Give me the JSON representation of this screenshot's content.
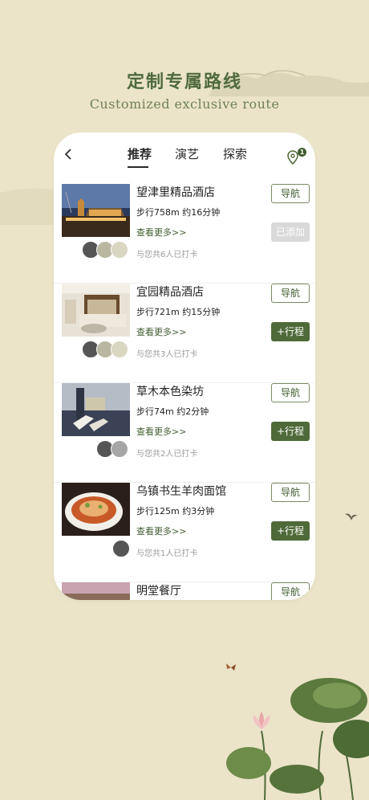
{
  "header": {
    "title": "定制专属路线",
    "subtitle": "Customized exclusive route"
  },
  "tabs": [
    {
      "label": "推荐",
      "active": true
    },
    {
      "label": "演艺",
      "active": false
    },
    {
      "label": "探索",
      "active": false
    }
  ],
  "location_badge": "1",
  "items": [
    {
      "name": "望津里精品酒店",
      "distance": "步行758m 约16分钟",
      "more": "查看更多>>",
      "checkin": "与您共6人已打卡",
      "nav_label": "导航",
      "action_label": "已添加",
      "action_state": "added",
      "avatars": 3
    },
    {
      "name": "宜园精品酒店",
      "distance": "步行721m 约15分钟",
      "more": "查看更多>>",
      "checkin": "与您共3人已打卡",
      "nav_label": "导航",
      "action_label": "+行程",
      "action_state": "add",
      "avatars": 3
    },
    {
      "name": "草木本色染坊",
      "distance": "步行74m 约2分钟",
      "more": "查看更多>>",
      "checkin": "与您共2人已打卡",
      "nav_label": "导航",
      "action_label": "+行程",
      "action_state": "add",
      "avatars": 2
    },
    {
      "name": "乌镇书生羊肉面馆",
      "distance": "步行125m 约3分钟",
      "more": "查看更多>>",
      "checkin": "与您共1人已打卡",
      "nav_label": "导航",
      "action_label": "+行程",
      "action_state": "add",
      "avatars": 1
    },
    {
      "name": "明堂餐厅",
      "nav_label": "导航"
    }
  ],
  "colors": {
    "background": "#ebe4c9",
    "accent_green": "#4e6a38",
    "title_green": "#4f6a3d",
    "added_gray": "#d9d9d9"
  },
  "icons": [
    "back-arrow-icon",
    "location-pin-icon"
  ]
}
